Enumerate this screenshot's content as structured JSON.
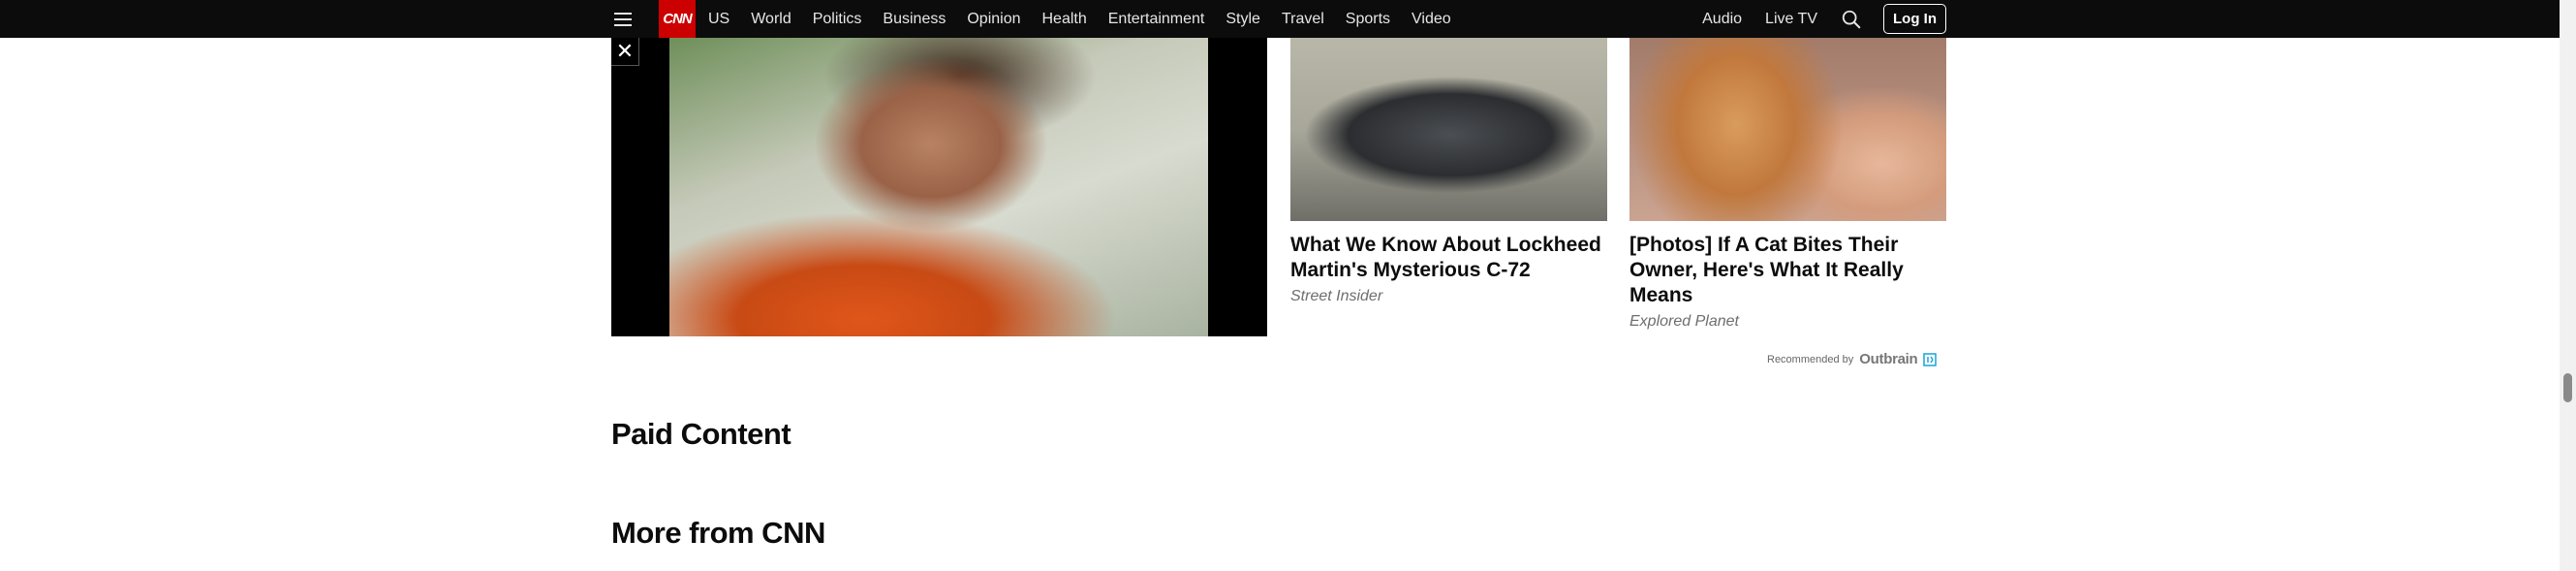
{
  "nav": {
    "logo": "CNN",
    "menu_icon": "hamburger-menu-icon",
    "links": [
      "US",
      "World",
      "Politics",
      "Business",
      "Opinion",
      "Health",
      "Entertainment",
      "Style",
      "Travel",
      "Sports",
      "Video"
    ],
    "audio": "Audio",
    "live_tv": "Live TV",
    "search_icon": "search-icon",
    "login": "Log In",
    "brand_color": "#cc0000"
  },
  "video": {
    "close_glyph": "✕"
  },
  "cards": [
    {
      "title": "What We Know About Lockheed Martin's Mysterious C-72",
      "source": "Street Insider"
    },
    {
      "title": "[Photos] If A Cat Bites Their Owner, Here's What It Really Means",
      "source": "Explored Planet"
    }
  ],
  "recommended": {
    "by": "Recommended by",
    "brand": "Outbrain"
  },
  "sections": {
    "paid_content": "Paid Content",
    "more_from": "More from CNN"
  }
}
